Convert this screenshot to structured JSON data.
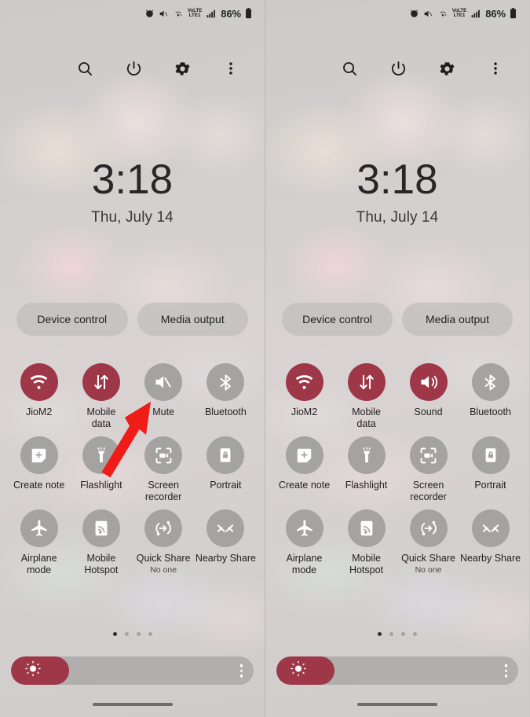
{
  "accent": "#9e3747",
  "inactive": "#a5a2a2",
  "statusbar": {
    "icons": [
      "alarm-icon",
      "mute-icon",
      "wifi-icon",
      "volte-icon",
      "signal-icon"
    ],
    "volte_top": "VoLTE",
    "volte_bottom": "LTE1",
    "battery_percent": "86%"
  },
  "header": {
    "search_label": "Search",
    "power_label": "Power off",
    "settings_label": "Settings",
    "more_label": "More options"
  },
  "clock": {
    "time": "3:18",
    "date": "Thu, July 14"
  },
  "pills": {
    "device_control": "Device control",
    "media_output": "Media output"
  },
  "panels": [
    {
      "id": "left",
      "tiles": [
        [
          {
            "label": "JioM2",
            "icon": "wifi-icon",
            "active": true
          },
          {
            "label": "Mobile\ndata",
            "icon": "mobile-data-icon",
            "active": true
          },
          {
            "label": "Mute",
            "icon": "speaker-mute-icon",
            "active": false
          },
          {
            "label": "Bluetooth",
            "icon": "bluetooth-icon",
            "active": false
          }
        ],
        [
          {
            "label": "Create note",
            "icon": "create-note-icon",
            "active": false
          },
          {
            "label": "Flashlight",
            "icon": "flashlight-icon",
            "active": false
          },
          {
            "label": "Screen\nrecorder",
            "icon": "screen-recorder-icon",
            "active": false
          },
          {
            "label": "Portrait",
            "icon": "rotation-lock-icon",
            "active": false
          }
        ],
        [
          {
            "label": "Airplane\nmode",
            "icon": "airplane-icon",
            "active": false
          },
          {
            "label": "Mobile\nHotspot",
            "icon": "hotspot-icon",
            "active": false
          },
          {
            "label": "Quick Share",
            "sub": "No one",
            "icon": "quick-share-icon",
            "active": false
          },
          {
            "label": "Nearby Share",
            "icon": "nearby-share-icon",
            "active": false
          }
        ]
      ]
    },
    {
      "id": "right",
      "tiles": [
        [
          {
            "label": "JioM2",
            "icon": "wifi-icon",
            "active": true
          },
          {
            "label": "Mobile\ndata",
            "icon": "mobile-data-icon",
            "active": true
          },
          {
            "label": "Sound",
            "icon": "speaker-on-icon",
            "active": true
          },
          {
            "label": "Bluetooth",
            "icon": "bluetooth-icon",
            "active": false
          }
        ],
        [
          {
            "label": "Create note",
            "icon": "create-note-icon",
            "active": false
          },
          {
            "label": "Flashlight",
            "icon": "flashlight-icon",
            "active": false
          },
          {
            "label": "Screen\nrecorder",
            "icon": "screen-recorder-icon",
            "active": false
          },
          {
            "label": "Portrait",
            "icon": "rotation-lock-icon",
            "active": false
          }
        ],
        [
          {
            "label": "Airplane\nmode",
            "icon": "airplane-icon",
            "active": false
          },
          {
            "label": "Mobile\nHotspot",
            "icon": "hotspot-icon",
            "active": false
          },
          {
            "label": "Quick Share",
            "sub": "No one",
            "icon": "quick-share-icon",
            "active": false
          },
          {
            "label": "Nearby Share",
            "icon": "nearby-share-icon",
            "active": false
          }
        ]
      ]
    }
  ],
  "pager": {
    "count": 4,
    "active_index": 0
  },
  "brightness": {
    "percent": 24,
    "icon": "brightness-sun-icon",
    "menu_icon": "more-vertical-icon"
  },
  "annotation": {
    "type": "arrow",
    "color": "#f01c18",
    "points_to": "mute-tile"
  }
}
